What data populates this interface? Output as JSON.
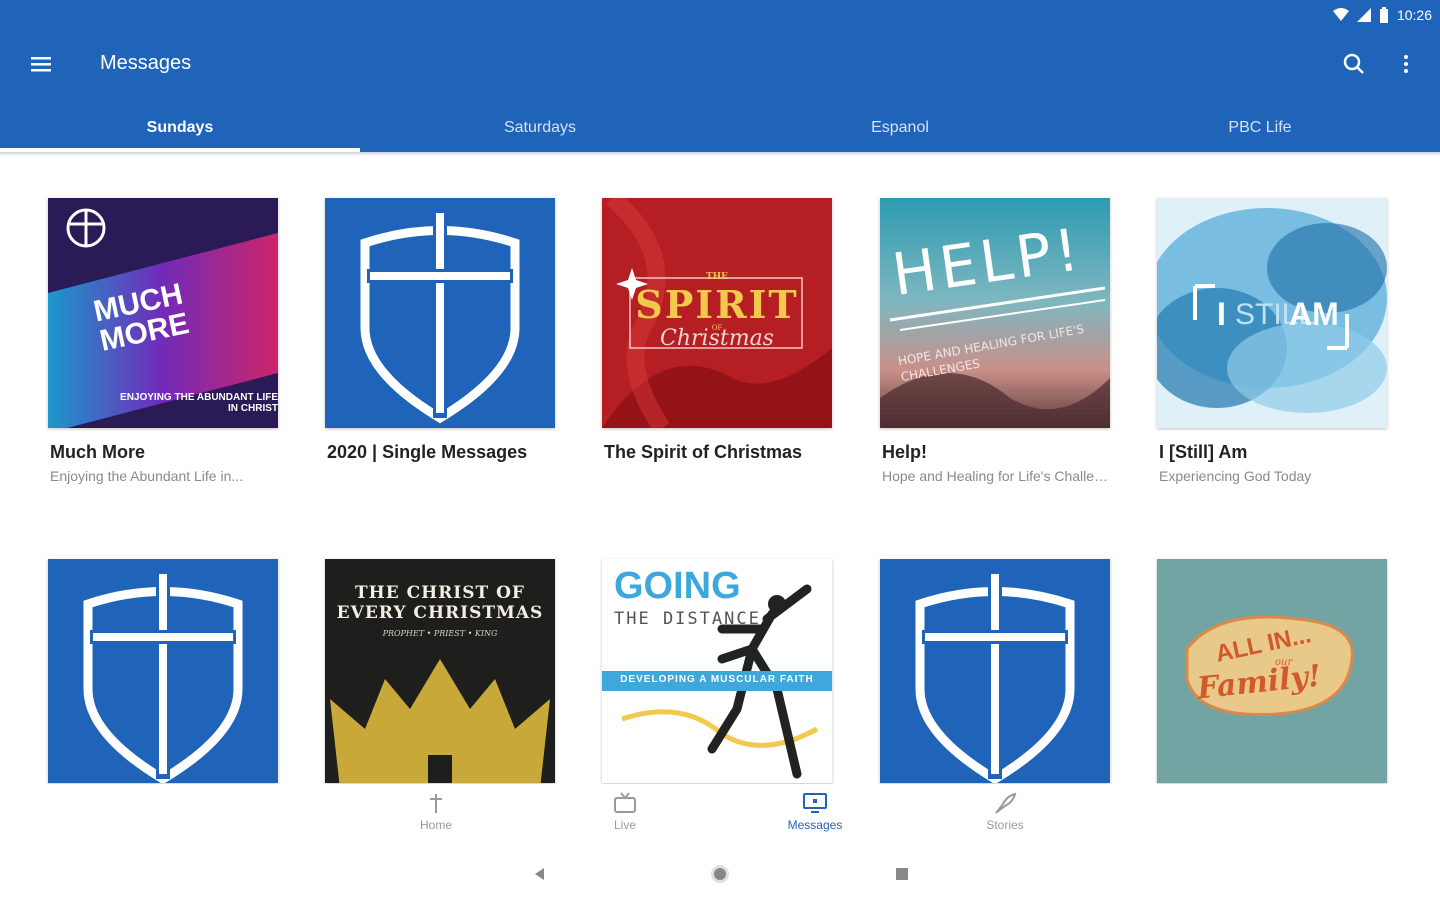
{
  "status_bar": {
    "time": "10:26"
  },
  "app_bar": {
    "title": "Messages"
  },
  "tabs": [
    {
      "label": "Sundays",
      "active": true
    },
    {
      "label": "Saturdays",
      "active": false
    },
    {
      "label": "Espanol",
      "active": false
    },
    {
      "label": "PBC Life",
      "active": false
    }
  ],
  "series": [
    {
      "title": "Much More",
      "subtitle": "Enjoying the Abundant Life in...",
      "art": {
        "main": "MUCH MORE",
        "caption": "ENJOYING THE ABUNDANT LIFE IN CHRIST",
        "bg": "#2b1a55"
      }
    },
    {
      "title": "2020 | Single Messages",
      "subtitle": "",
      "art": {
        "bg": "#1f64b8"
      }
    },
    {
      "title": "The Spirit of Christmas",
      "subtitle": "",
      "art": {
        "kicker": "THE",
        "main": "SPIRIT",
        "small": "OF",
        "script": "Christmas",
        "bg": "#b71c1c"
      }
    },
    {
      "title": "Help!",
      "subtitle": "Hope and Healing for Life's Challenges",
      "art": {
        "main": "HELP!",
        "caption": "HOPE AND HEALING FOR LIFE'S CHALLENGES",
        "bg": "#3a8fa0"
      }
    },
    {
      "title": "I [Still] Am",
      "subtitle": "Experiencing God Today",
      "art": {
        "left": "I",
        "middle": "STILL",
        "right": "AM",
        "bg": "#5aa8d6"
      }
    },
    {
      "title": "",
      "subtitle": "",
      "art": {
        "bg": "#1f64b8"
      }
    },
    {
      "title": "",
      "subtitle": "",
      "art": {
        "main": "THE CHRIST OF EVERY CHRISTMAS",
        "caption": "PROPHET • PRIEST • KING",
        "bg": "#1d1d1b"
      }
    },
    {
      "title": "",
      "subtitle": "",
      "art": {
        "main": "GOING",
        "sub": "THE DISTANCE",
        "band": "DEVELOPING A MUSCULAR FAITH",
        "bg": "#ffffff"
      }
    },
    {
      "title": "",
      "subtitle": "",
      "art": {
        "bg": "#1f64b8"
      }
    },
    {
      "title": "",
      "subtitle": "",
      "art": {
        "main": "ALL IN...",
        "small": "our",
        "script": "Family!",
        "bg": "#6fa3a3"
      }
    }
  ],
  "bottom_nav": [
    {
      "label": "Home",
      "icon": "cross-icon",
      "active": false
    },
    {
      "label": "Live",
      "icon": "tv-icon",
      "active": false
    },
    {
      "label": "Messages",
      "icon": "monitor-icon",
      "active": true
    },
    {
      "label": "Stories",
      "icon": "quill-icon",
      "active": false
    }
  ],
  "colors": {
    "primary": "#1f64b8",
    "active_nav": "#1f64b8",
    "inactive": "#9a9a9a"
  }
}
